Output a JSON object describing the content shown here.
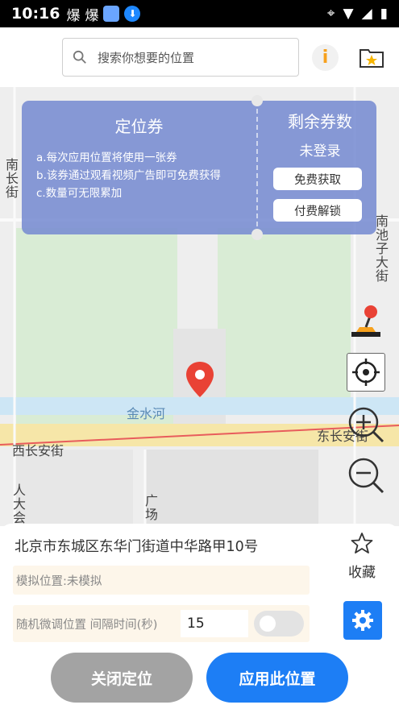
{
  "status_bar": {
    "time": "10:16",
    "notification_icons": [
      "爆",
      "爆"
    ],
    "icons": [
      "location-icon",
      "wifi-icon",
      "signal-icon",
      "battery-icon"
    ]
  },
  "search": {
    "placeholder": "搜索你想要的位置"
  },
  "header": {
    "info_label": "i"
  },
  "coupon": {
    "title": "定位券",
    "lines": [
      "a.每次应用位置将使用一张券",
      "b.该券通过观看视频广告即可免费获得",
      "c.数量可无限累加"
    ],
    "remaining_title": "剩余券数",
    "remaining_value": "未登录",
    "free_button": "免费获取",
    "paid_button": "付费解锁"
  },
  "map": {
    "labels": {
      "nanchang": "南长街",
      "nanchizi": "南池子大街",
      "jinshui": "金水河",
      "xichangan": "西长安街",
      "dongchangan": "东长安街",
      "renda": "人大会",
      "guangchang": "广场"
    }
  },
  "sheet": {
    "address": "北京市东城区东华门街道中华路甲10号",
    "favorite_label": "收藏",
    "sim_status": "模拟位置:未模拟",
    "random_label": "随机微调位置 间隔时间(秒)",
    "interval_value": "15",
    "random_enabled": false,
    "close_button": "关闭定位",
    "apply_button": "应用此位置"
  },
  "colors": {
    "accent": "#1d7ef5",
    "coupon": "#7f8fd3",
    "close_button": "#a3a3a3",
    "pin": "#e94235"
  }
}
